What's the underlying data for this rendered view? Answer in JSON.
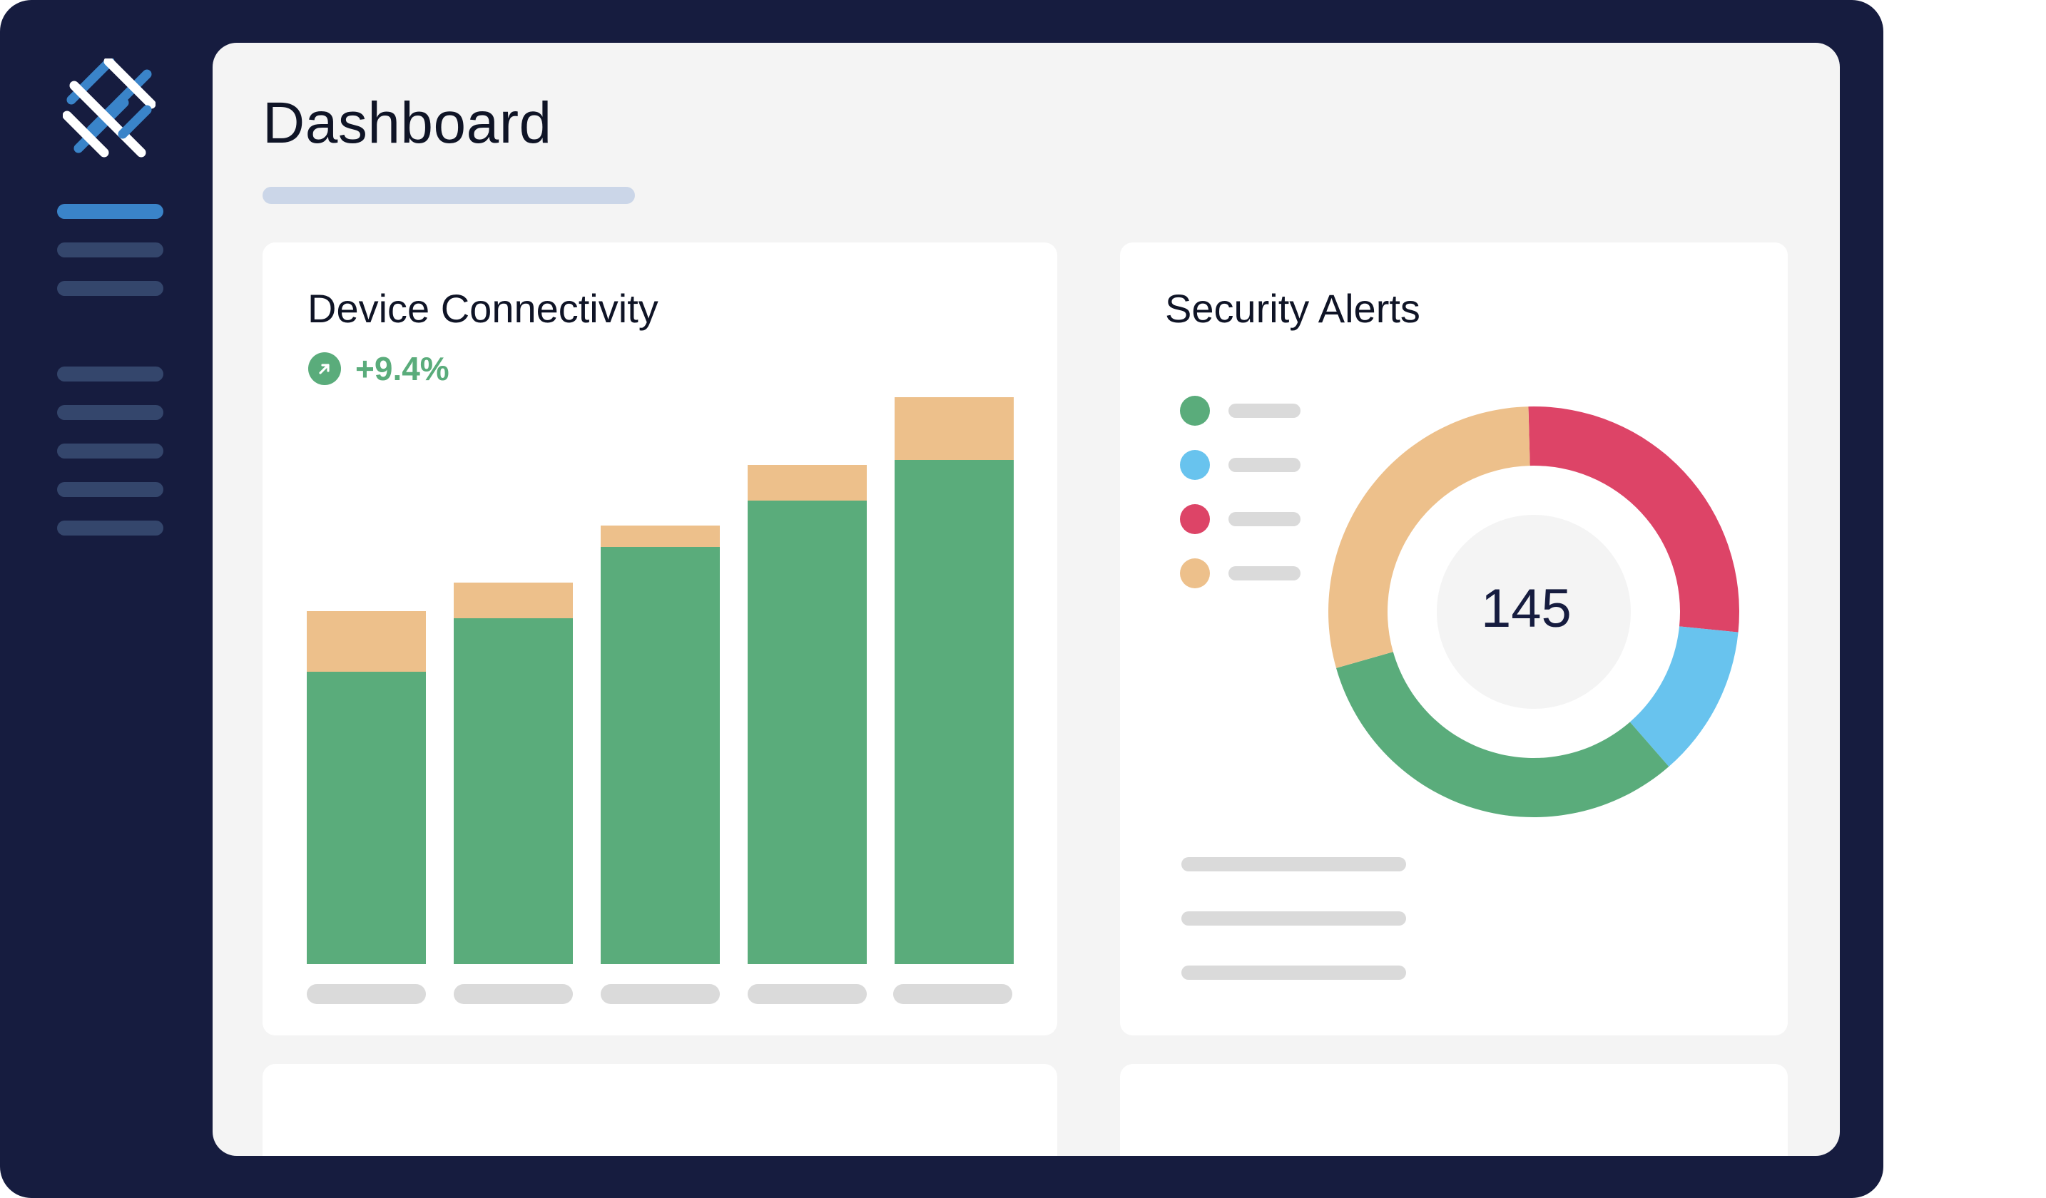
{
  "page": {
    "title": "Dashboard"
  },
  "colors": {
    "frame": "#161c3f",
    "nav_active": "#3a84c9",
    "nav_inactive": "#34466c",
    "green": "#5aac7b",
    "peach": "#edc08b",
    "red": "#dd4467",
    "blue": "#68c3ee",
    "placeholder": "#dadada"
  },
  "sidebar": {
    "logo_icon": "woven-lattice-logo-icon",
    "items": [
      {
        "state": "active"
      },
      {
        "state": "inactive"
      },
      {
        "state": "inactive"
      },
      {
        "state": "inactive"
      },
      {
        "state": "inactive"
      },
      {
        "state": "inactive"
      },
      {
        "state": "inactive"
      },
      {
        "state": "inactive"
      }
    ]
  },
  "device_connectivity": {
    "title": "Device Connectivity",
    "trend_icon": "arrow-up-right-icon",
    "trend": "+9.4%"
  },
  "security_alerts": {
    "title": "Security Alerts",
    "total": "145"
  },
  "chart_data": [
    {
      "type": "bar",
      "stacked": true,
      "series": [
        {
          "color": "#5aac7b",
          "values": [
            410,
            485,
            585,
            650,
            707
          ]
        },
        {
          "color": "#edc08b",
          "values": [
            85,
            50,
            30,
            50,
            88
          ]
        }
      ],
      "ylim": [
        0,
        795
      ]
    },
    {
      "type": "pie",
      "donut": true,
      "center_label": "145",
      "slices": [
        {
          "color": "#dd4467",
          "value": 27
        },
        {
          "color": "#68c3ee",
          "value": 12
        },
        {
          "color": "#5aac7b",
          "value": 32
        },
        {
          "color": "#edc08b",
          "value": 29
        }
      ]
    }
  ]
}
